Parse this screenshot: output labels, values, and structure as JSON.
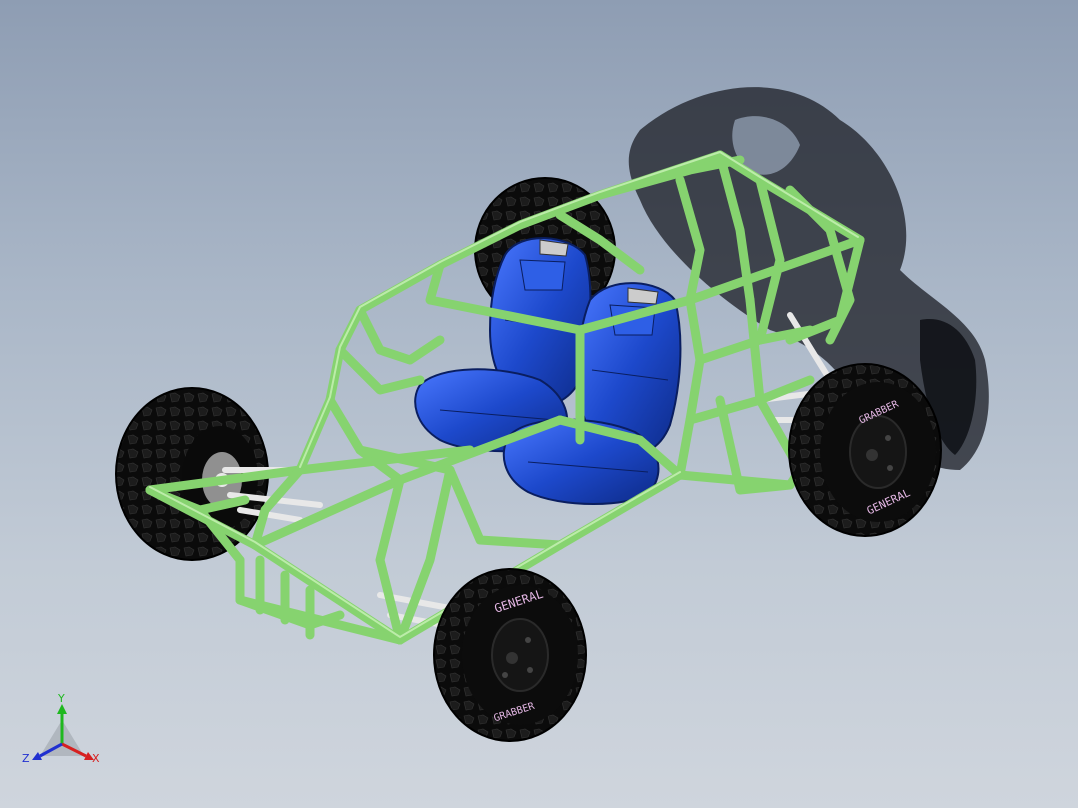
{
  "viewport": {
    "background_top": "#8e9db3",
    "background_bottom": "#cfd5dd"
  },
  "model": {
    "frame_color": "#86d36f",
    "seat_color": "#1f4fd0",
    "tire_color": "#0c0c0c",
    "tire_lettering_color": "#e6b8e6",
    "tire_lettering_top": "GENERAL",
    "tire_lettering_bottom": "GRABBER",
    "suspension_color": "#e8e8e8",
    "shadow_color": "#2c2f36"
  },
  "triad": {
    "x_label": "X",
    "y_label": "Y",
    "z_label": "Z",
    "x_color": "#d62020",
    "y_color": "#1fb81f",
    "z_color": "#2030d0"
  }
}
